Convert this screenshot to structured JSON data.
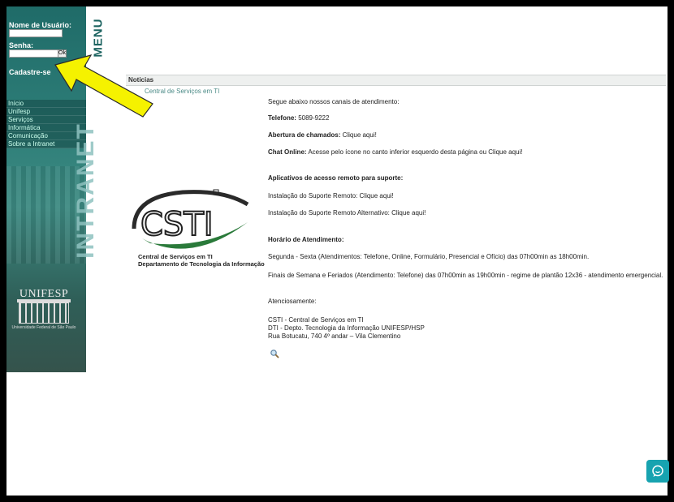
{
  "login": {
    "username_label": "Nome de Usuário:",
    "password_label": "Senha:",
    "ok_label": "Ok",
    "register_label": "Cadastre-se"
  },
  "menu": {
    "title": "MENU",
    "items": [
      {
        "label": "Início"
      },
      {
        "label": "Unifesp"
      },
      {
        "label": "Serviços"
      },
      {
        "label": "Informática"
      },
      {
        "label": "Comunicação"
      },
      {
        "label": "Sobre a Intranet"
      }
    ]
  },
  "intranet_label": "INTRANET",
  "unifesp": {
    "name": "UNIFESP",
    "subtitle": "Universidade Federal de São Paulo"
  },
  "page": {
    "section_title": "Noticias",
    "breadcrumb": "Central de Serviços em TI"
  },
  "csti": {
    "logo_text": "CSTI",
    "caption_line1": "Central de Serviços em TI",
    "caption_line2": "Departamento de Tecnologia da Informação"
  },
  "content": {
    "intro": "Segue abaixo nossos canais de atendimento:",
    "phone_label": "Telefone:",
    "phone_value": " 5089-9222",
    "tickets_label": "Abertura de chamados:",
    "tickets_link": " Clique aqui!",
    "chat_label": "Chat Online:",
    "chat_text": " Acesse pelo ícone no canto inferior esquerdo desta página ou Clique aqui!",
    "remote_heading": "Aplicativos de acesso remoto para suporte:",
    "remote1": "Instalação do Suporte Remoto: Clique aqui!",
    "remote2": "Instalação do Suporte Remoto Alternativo: Clique aqui!",
    "hours_heading": "Horário de Atendimento:",
    "hours1": "Segunda - Sexta (Atendimentos: Telefone, Online, Formulário, Presencial e Ofício) das 07h00min as 18h00min.",
    "hours2": "Finais de Semana e Feriados (Atendimento: Telefone) das 07h00min as 19h00min - regime de plantão 12x36 - atendimento emergencial.",
    "regards": "Atenciosamente:",
    "sig1": "CSTI - Central de Serviços em TI",
    "sig2": "DTI - Depto. Tecnologia da Informação UNIFESP/HSP",
    "sig3": "Rua Botucatu, 740 4º andar – Vila Clementino"
  },
  "colors": {
    "sidebar": "#2f7f79",
    "arrow": "#f5f200",
    "chat": "#17a3b0"
  },
  "icons": {
    "search": "magnifier-icon",
    "chat": "chat-bubble-icon",
    "arrow": "yellow-arrow"
  }
}
